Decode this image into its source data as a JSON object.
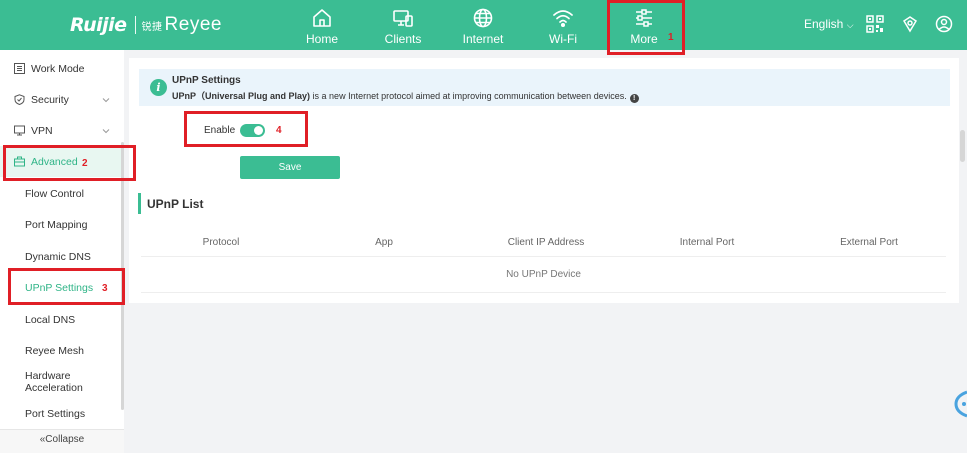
{
  "brand": {
    "logo_main": "Ruijie",
    "logo_secondary": "Reyee",
    "logo_prefix": "锐捷"
  },
  "nav": {
    "items": [
      {
        "label": "Home",
        "icon": "home-icon"
      },
      {
        "label": "Clients",
        "icon": "monitor-icon"
      },
      {
        "label": "Internet",
        "icon": "globe-icon"
      },
      {
        "label": "Wi-Fi",
        "icon": "wifi-icon"
      },
      {
        "label": "More",
        "icon": "sliders-icon"
      }
    ],
    "language": "English",
    "active": "More"
  },
  "sidebar": {
    "items": [
      {
        "label": "Work Mode",
        "icon": "list-icon"
      },
      {
        "label": "Security",
        "icon": "shield-icon"
      },
      {
        "label": "VPN",
        "icon": "vpn-icon"
      },
      {
        "label": "Advanced",
        "icon": "briefcase-icon"
      }
    ],
    "sub_items": [
      {
        "label": "Flow Control"
      },
      {
        "label": "Port Mapping"
      },
      {
        "label": "Dynamic DNS"
      },
      {
        "label": "UPnP Settings"
      },
      {
        "label": "Local DNS"
      },
      {
        "label": "Reyee Mesh"
      },
      {
        "label": "Hardware Acceleration"
      },
      {
        "label": "Port Settings"
      }
    ],
    "collapse_label": "«Collapse"
  },
  "annotations": [
    "1",
    "2",
    "3",
    "4"
  ],
  "upnp": {
    "title": "UPnP Settings",
    "desc_bold": "UPnP（Universal Plug and Play)",
    "desc_rest": " is a new Internet protocol aimed at improving communication between devices.",
    "enable_label": "Enable",
    "enabled": true,
    "save_label": "Save"
  },
  "upnp_list": {
    "title": "UPnP List",
    "columns": [
      "Protocol",
      "App",
      "Client IP Address",
      "Internal Port",
      "External Port"
    ],
    "empty_text": "No UPnP Device"
  },
  "colors": {
    "brand": "#3bbd93",
    "annotation": "#e01f26"
  }
}
